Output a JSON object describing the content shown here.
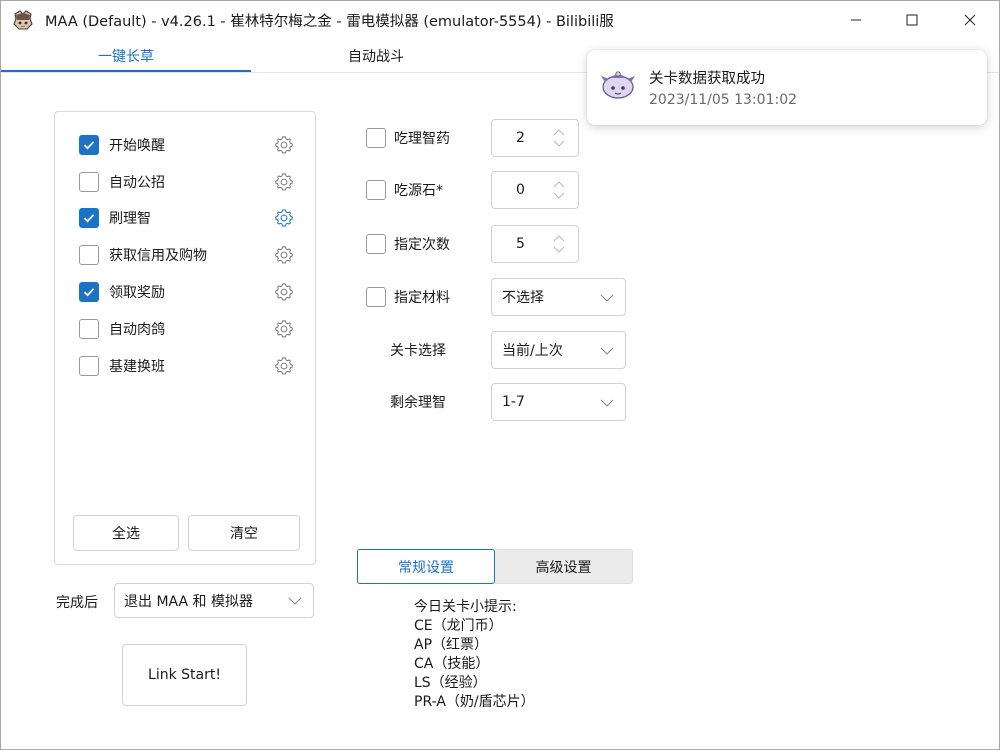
{
  "window": {
    "title": "MAA (Default) - v4.26.1 - 崔林特尔梅之金 - 雷电模拟器 (emulator-5554) - Bilibili服",
    "controls": [
      "minimize-icon",
      "maximize-icon",
      "close-icon"
    ]
  },
  "tabs": [
    {
      "label": "一键长草",
      "active": true
    },
    {
      "label": "自动战斗",
      "active": false
    }
  ],
  "accent_color": "#1a73c7",
  "tasks": [
    {
      "label": "开始唤醒",
      "checked": true,
      "icon": "gear-icon"
    },
    {
      "label": "自动公招",
      "checked": false,
      "icon": "gear-icon"
    },
    {
      "label": "刷理智",
      "checked": true,
      "icon": "gear-icon",
      "gear_active": true
    },
    {
      "label": "获取信用及购物",
      "checked": false,
      "icon": "gear-icon"
    },
    {
      "label": "领取奖励",
      "checked": true,
      "icon": "gear-icon"
    },
    {
      "label": "自动肉鸽",
      "checked": false,
      "icon": "gear-icon"
    },
    {
      "label": "基建换班",
      "checked": false,
      "icon": "gear-icon"
    }
  ],
  "task_buttons": {
    "select_all": "全选",
    "clear": "清空"
  },
  "after_completion": {
    "label": "完成后",
    "value": "退出 MAA 和 模拟器"
  },
  "link_start": "Link Start!",
  "options": {
    "use_sanity_potion": {
      "label": "吃理智药",
      "checked": false,
      "value": "2"
    },
    "use_originium": {
      "label": "吃源石*",
      "checked": false,
      "value": "0"
    },
    "times": {
      "label": "指定次数",
      "checked": false,
      "value": "5"
    },
    "material": {
      "label": "指定材料",
      "checked": false,
      "value": "不选择"
    },
    "stage": {
      "label": "关卡选择",
      "value": "当前/上次"
    },
    "remaining_sanity": {
      "label": "剩余理智",
      "value": "1-7"
    }
  },
  "settings_tabs": {
    "normal": "常规设置",
    "advanced": "高级设置",
    "active": "normal"
  },
  "tips": {
    "title": "今日关卡小提示:",
    "lines": [
      "CE（龙门币）",
      "AP（红票）",
      "CA（技能）",
      "LS（经验）",
      "PR-A（奶/盾芯片）"
    ]
  },
  "toast": {
    "title": "关卡数据获取成功",
    "time": "2023/11/05 13:01:02"
  }
}
